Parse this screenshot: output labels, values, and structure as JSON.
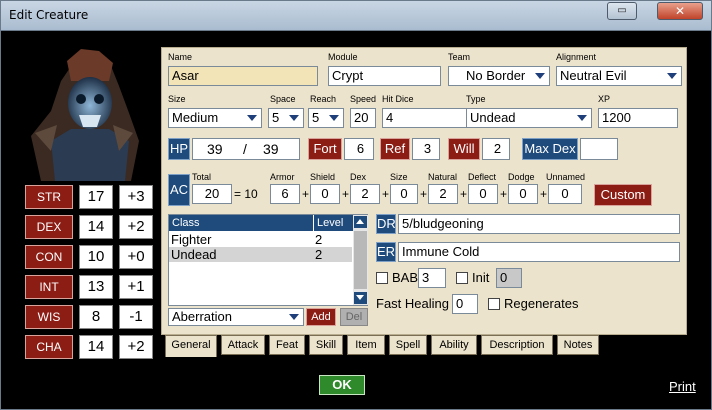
{
  "window": {
    "title": "Edit Creature"
  },
  "colors": {
    "accent_red": "#8c1d14",
    "accent_blue": "#1e4a7c",
    "panel": "#ece3cc",
    "ok_green": "#2e8a2a"
  },
  "abilities": [
    {
      "name": "STR",
      "score": "17",
      "mod": "+3"
    },
    {
      "name": "DEX",
      "score": "14",
      "mod": "+2"
    },
    {
      "name": "CON",
      "score": "10",
      "mod": "+0"
    },
    {
      "name": "INT",
      "score": "13",
      "mod": "+1"
    },
    {
      "name": "WIS",
      "score": "8",
      "mod": "-1"
    },
    {
      "name": "CHA",
      "score": "14",
      "mod": "+2"
    }
  ],
  "general": {
    "name_label": "Name",
    "name": "Asar",
    "module_label": "Module",
    "module": "Crypt",
    "team_label": "Team",
    "team": "No Border",
    "alignment_label": "Alignment",
    "alignment": "Neutral Evil",
    "size_label": "Size",
    "size": "Medium",
    "space_label": "Space",
    "space": "5",
    "reach_label": "Reach",
    "reach": "5",
    "speed_label": "Speed",
    "speed": "20",
    "hitdice_label": "Hit Dice",
    "hitdice": "4",
    "type_label": "Type",
    "type": "Undead",
    "xp_label": "XP",
    "xp": "1200"
  },
  "hp": {
    "label": "HP",
    "current": "39",
    "separator": "/",
    "max": "39"
  },
  "saves": [
    {
      "label": "Fort",
      "value": "6"
    },
    {
      "label": "Ref",
      "value": "3"
    },
    {
      "label": "Will",
      "value": "2"
    }
  ],
  "maxdex": {
    "label": "Max Dex",
    "value": ""
  },
  "ac": {
    "label": "AC",
    "total_label": "Total",
    "total": "20",
    "equals": "= 10",
    "parts": [
      {
        "label": "Armor",
        "value": "6"
      },
      {
        "label": "Shield",
        "value": "0"
      },
      {
        "label": "Dex",
        "value": "2"
      },
      {
        "label": "Size",
        "value": "0"
      },
      {
        "label": "Natural",
        "value": "2"
      },
      {
        "label": "Deflect",
        "value": "0"
      },
      {
        "label": "Dodge",
        "value": "0"
      },
      {
        "label": "Unnamed",
        "value": "0"
      }
    ],
    "custom_label": "Custom"
  },
  "classes": {
    "header_class": "Class",
    "header_level": "Level",
    "rows": [
      {
        "class": "Fighter",
        "level": "2"
      },
      {
        "class": "Undead",
        "level": "2"
      }
    ],
    "picker": "Aberration",
    "add_label": "Add",
    "del_label": "Del"
  },
  "defenses": {
    "dr_label": "DR",
    "dr": "5/bludgeoning",
    "er_label": "ER",
    "er": "Immune Cold",
    "bab_label": "BAB",
    "bab": "3",
    "init_label": "Init",
    "init": "0",
    "fast_healing_label": "Fast Healing",
    "fast_healing": "0",
    "regenerates_label": "Regenerates"
  },
  "tabs": [
    "General",
    "Attack",
    "Feat",
    "Skill",
    "Item",
    "Spell",
    "Ability",
    "Description",
    "Notes"
  ],
  "footer": {
    "ok_label": "OK",
    "print_label": "Print"
  }
}
